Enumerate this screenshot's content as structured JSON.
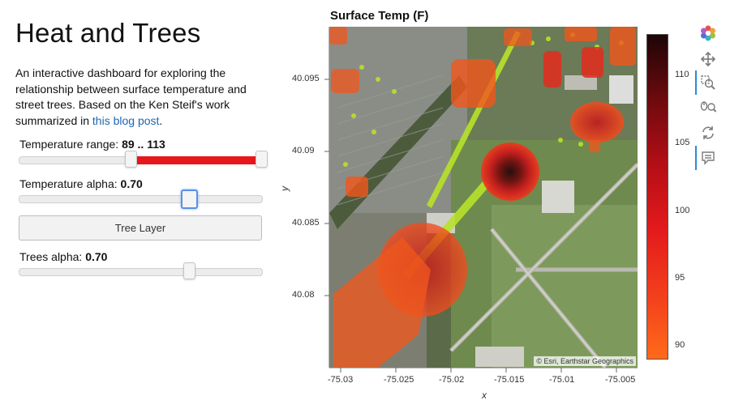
{
  "title": "Heat and Trees",
  "description": {
    "text": "An interactive dashboard for exploring the relationship between surface temperature and street trees. Based on the Ken Steif's work summarized in ",
    "link": "this blog post",
    "end": "."
  },
  "controls": {
    "temp_range": {
      "label": "Temperature range: ",
      "value": "89 .. 113",
      "low": 89,
      "high": 113
    },
    "temp_alpha": {
      "label": "Temperature alpha: ",
      "value": "0.70",
      "fraction": 0.7
    },
    "tree_button": "Tree Layer",
    "trees_alpha": {
      "label": "Trees alpha: ",
      "value": "0.70",
      "fraction": 0.7
    }
  },
  "plot": {
    "title": "Surface Temp (F)",
    "xlabel": "x",
    "ylabel": "y",
    "xticks": [
      "-75.03",
      "-75.025",
      "-75.02",
      "-75.015",
      "-75.01",
      "-75.005"
    ],
    "yticks": [
      "40.095",
      "40.09",
      "40.085",
      "40.08"
    ],
    "attribution": "© Esri, Earthstar Geographics",
    "colorbar": {
      "ticks": [
        "110",
        "105",
        "100",
        "95",
        "90"
      ],
      "min": 89,
      "max": 113
    }
  },
  "toolbar": {
    "logo": "bokeh-logo-icon",
    "tools": [
      "pan-icon",
      "box-zoom-icon",
      "wheel-zoom-icon",
      "reset-icon",
      "hover-icon"
    ]
  },
  "chart_data": {
    "type": "heatmap",
    "title": "Surface Temp (F)",
    "xlabel": "x",
    "ylabel": "y",
    "xlim": [
      -75.032,
      -75.0035
    ],
    "ylim": [
      40.0755,
      40.0985
    ],
    "color_range": [
      89,
      113
    ],
    "hotspots": [
      {
        "x": -75.0155,
        "y": 40.0892,
        "value": 113
      },
      {
        "x": -75.0235,
        "y": 40.0828,
        "value": 100
      },
      {
        "x": -75.027,
        "y": 40.079,
        "value": 96
      },
      {
        "x": -75.01,
        "y": 40.092,
        "value": 99
      },
      {
        "x": -75.0125,
        "y": 40.096,
        "value": 96
      },
      {
        "x": -75.0065,
        "y": 40.0965,
        "value": 96
      },
      {
        "x": -75.019,
        "y": 40.0955,
        "value": 93
      },
      {
        "x": -75.03,
        "y": 40.0955,
        "value": 92
      },
      {
        "x": -75.029,
        "y": 40.0875,
        "value": 92
      },
      {
        "x": -75.0085,
        "y": 40.0985,
        "value": 92
      },
      {
        "x": -75.004,
        "y": 40.098,
        "value": 93
      },
      {
        "x": -75.014,
        "y": 40.0985,
        "value": 91
      },
      {
        "x": -75.0045,
        "y": 40.0885,
        "value": 91
      }
    ]
  }
}
